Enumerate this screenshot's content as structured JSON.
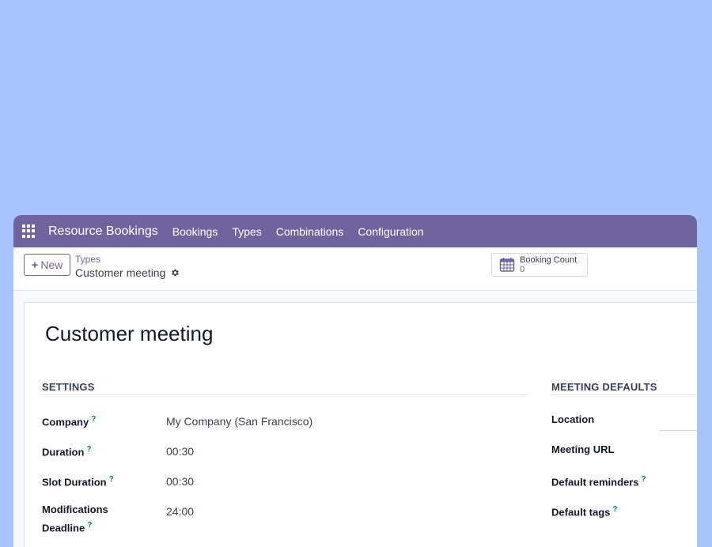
{
  "navbar": {
    "app_name": "Resource Bookings",
    "menu": [
      "Bookings",
      "Types",
      "Combinations",
      "Configuration"
    ]
  },
  "control": {
    "new_label": "New",
    "breadcrumb_parent": "Types",
    "breadcrumb_current": "Customer meeting",
    "smart_button": {
      "label": "Booking Count",
      "value": "0"
    }
  },
  "form": {
    "title": "Customer meeting",
    "settings": {
      "title": "SETTINGS",
      "fields": [
        {
          "label": "Company",
          "value": "My Company (San Francisco)"
        },
        {
          "label": "Duration",
          "value": "00:30"
        },
        {
          "label": "Slot Duration",
          "value": "00:30"
        },
        {
          "label_line1": "Modifications",
          "label_line2": "Deadline",
          "value": "24:00"
        }
      ]
    },
    "meeting_defaults": {
      "title": "MEETING DEFAULTS",
      "fields": [
        {
          "label": "Location",
          "value": ""
        },
        {
          "label": "Meeting URL",
          "value": ""
        },
        {
          "label": "Default reminders",
          "value": ""
        },
        {
          "label": "Default tags",
          "value": ""
        }
      ]
    },
    "help_mark": "?"
  },
  "colors": {
    "background": "#a7c4fd",
    "navbar": "#71639e",
    "accent": "#71639e",
    "help": "#017e84"
  },
  "icons": {
    "apps": "apps-grid-icon",
    "gear": "gear-icon",
    "calendar": "calendar-icon",
    "plus": "plus-icon"
  }
}
